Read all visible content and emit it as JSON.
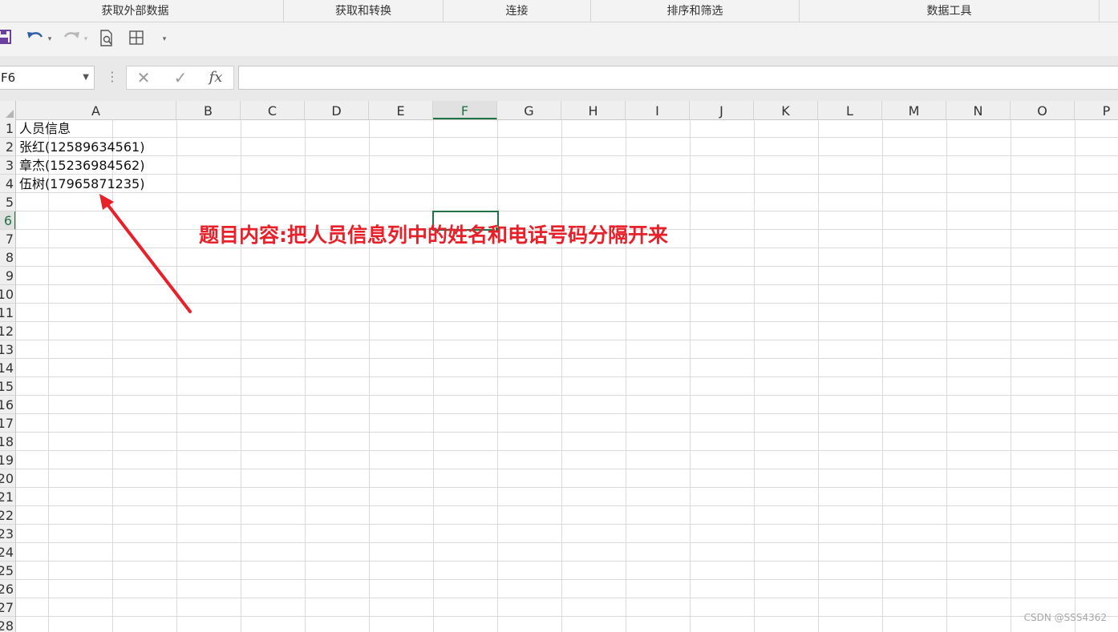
{
  "ribbon": {
    "groups": [
      {
        "label": "获取外部数据"
      },
      {
        "label": "获取和转换"
      },
      {
        "label": "连接"
      },
      {
        "label": "排序和筛选"
      },
      {
        "label": "数据工具"
      }
    ]
  },
  "quick_access": {
    "icons": [
      "save-icon",
      "undo-icon",
      "redo-icon",
      "print-preview-icon",
      "borders-icon",
      "customize-dropdown-icon"
    ]
  },
  "formula_bar": {
    "name_box": "F6",
    "cancel_glyph": "✕",
    "enter_glyph": "✓",
    "fx_label": "fx",
    "formula_value": ""
  },
  "sheet": {
    "columns": [
      "A",
      "B",
      "C",
      "D",
      "E",
      "F",
      "G",
      "H",
      "I",
      "J",
      "K",
      "L",
      "M",
      "N",
      "O",
      "P"
    ],
    "active_column": "F",
    "rows": [
      "1",
      "2",
      "3",
      "4",
      "5",
      "6",
      "7",
      "8",
      "9",
      "10",
      "11",
      "12",
      "13",
      "14",
      "15",
      "16",
      "17",
      "18",
      "19",
      "20",
      "21",
      "22",
      "23",
      "24",
      "25",
      "26",
      "27",
      "28"
    ],
    "active_row": "6",
    "cells": {
      "A1": "人员信息",
      "A2": "张红(12589634561)",
      "A3": "章杰(15236984562)",
      "A4": "伍树(17965871235)"
    },
    "selected_cell": "F6"
  },
  "annotation": {
    "text": "题目内容:把人员信息列中的姓名和电话号码分隔开来",
    "color": "#e8202a"
  },
  "watermark": "CSDN @SSS4362",
  "colors": {
    "accent": "#217346",
    "annotation": "#e8202a"
  }
}
